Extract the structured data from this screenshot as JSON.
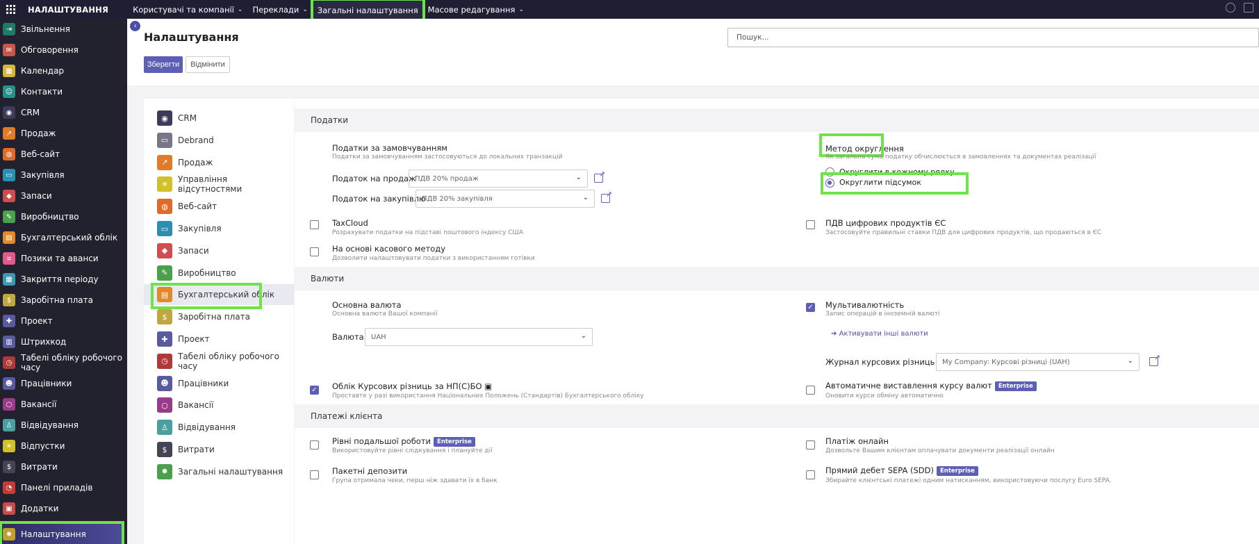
{
  "topbar": {
    "brand": "НАЛАШТУВАННЯ",
    "menu": [
      {
        "label": "Користувачі та компанії",
        "caret": true
      },
      {
        "label": "Переклади",
        "caret": true
      },
      {
        "label": "Загальні налаштування",
        "caret": false,
        "active": true
      },
      {
        "label": "Масове редагування",
        "caret": true
      }
    ]
  },
  "sidebar": {
    "items": [
      {
        "label": "Звільнення",
        "icon": "exit-icon",
        "color": "#1f7a6a"
      },
      {
        "label": "Обговорення",
        "icon": "chat-icon",
        "color": "#c8574b"
      },
      {
        "label": "Календар",
        "icon": "calendar-icon",
        "color": "#d2b73a"
      },
      {
        "label": "Контакти",
        "icon": "contacts-icon",
        "color": "#2a8f88"
      },
      {
        "label": "CRM",
        "icon": "crm-icon",
        "color": "#3c3c5a"
      },
      {
        "label": "Продаж",
        "icon": "chart-icon",
        "color": "#e07b2a"
      },
      {
        "label": "Веб-сайт",
        "icon": "globe-icon",
        "color": "#e06a2a"
      },
      {
        "label": "Закупівля",
        "icon": "card-icon",
        "color": "#2a8fb0"
      },
      {
        "label": "Запаси",
        "icon": "box-icon",
        "color": "#d24d4d"
      },
      {
        "label": "Виробництво",
        "icon": "wrench-icon",
        "color": "#4ba04b"
      },
      {
        "label": "Бухгалтерський облік",
        "icon": "ledger-icon",
        "color": "#e08a2a"
      },
      {
        "label": "Позики та аванси",
        "icon": "loan-icon",
        "color": "#e05a8a"
      },
      {
        "label": "Закриття періоду",
        "icon": "calendar-icon",
        "color": "#3a9ab0"
      },
      {
        "label": "Заробітна плата",
        "icon": "money-icon",
        "color": "#c0a840"
      },
      {
        "label": "Проект",
        "icon": "puzzle-icon",
        "color": "#5a5aa0"
      },
      {
        "label": "Штрихкод",
        "icon": "barcode-icon",
        "color": "#5a5aa0"
      },
      {
        "label": "Табелі обліку робочого часу",
        "icon": "clock-icon",
        "color": "#b03a3a"
      },
      {
        "label": "Працівники",
        "icon": "people-icon",
        "color": "#5a5aa0"
      },
      {
        "label": "Вакансії",
        "icon": "search-icon",
        "color": "#9a3a8a"
      },
      {
        "label": "Відвідування",
        "icon": "person-icon",
        "color": "#4aa0a0"
      },
      {
        "label": "Відпустки",
        "icon": "sun-icon",
        "color": "#d2c02a"
      },
      {
        "label": "Витрати",
        "icon": "dollar-icon",
        "color": "#444455"
      },
      {
        "label": "Панелі приладів",
        "icon": "gauge-icon",
        "color": "#c83a3a"
      },
      {
        "label": "Додатки",
        "icon": "apps-icon",
        "color": "#c84a4a"
      },
      {
        "label": "Налаштування",
        "icon": "gear-icon",
        "color": "#c0a030",
        "active": true
      }
    ]
  },
  "page": {
    "title": "Налаштування",
    "save": "Зберегти",
    "cancel": "Відмінити",
    "search_placeholder": "Пошук..."
  },
  "apps": [
    {
      "label": "CRM",
      "icon": "crm-icon",
      "color": "#3c3c5a"
    },
    {
      "label": "Debrand",
      "icon": "monitor-icon",
      "color": "#777788"
    },
    {
      "label": "Продаж",
      "icon": "chart-icon",
      "color": "#e07b2a"
    },
    {
      "label": "Управління відсутностями",
      "icon": "sun-icon",
      "color": "#d2c02a"
    },
    {
      "label": "Веб-сайт",
      "icon": "globe-icon",
      "color": "#e06a2a"
    },
    {
      "label": "Закупівля",
      "icon": "card-icon",
      "color": "#2a8fb0"
    },
    {
      "label": "Запаси",
      "icon": "box-icon",
      "color": "#d24d4d"
    },
    {
      "label": "Виробництво",
      "icon": "wrench-icon",
      "color": "#4ba04b"
    },
    {
      "label": "Бухгалтерський облік",
      "icon": "ledger-icon",
      "color": "#e08a2a",
      "active": true
    },
    {
      "label": "Заробітна плата",
      "icon": "money-icon",
      "color": "#c0a840"
    },
    {
      "label": "Проект",
      "icon": "puzzle-icon",
      "color": "#5a5aa0"
    },
    {
      "label": "Табелі обліку робочого часу",
      "icon": "clock-icon",
      "color": "#b03a3a"
    },
    {
      "label": "Працівники",
      "icon": "people-icon",
      "color": "#5a5aa0"
    },
    {
      "label": "Вакансії",
      "icon": "search-icon",
      "color": "#9a3a8a"
    },
    {
      "label": "Відвідування",
      "icon": "person-icon",
      "color": "#4aa0a0"
    },
    {
      "label": "Витрати",
      "icon": "dollar-icon",
      "color": "#444455"
    },
    {
      "label": "Загальні налаштування",
      "icon": "gear-icon",
      "color": "#4ba04b"
    }
  ],
  "taxes": {
    "section": "Податки",
    "default_taxes": {
      "title": "Податки за замовчуванням",
      "desc": "Податки за замовчуванням застосовуються до локальних транзакцій",
      "sales_label": "Податок на продаж",
      "sales_value": "ПДВ 20% продаж",
      "purchase_label": "Податок на закупівлю",
      "purchase_value": "ПДВ 20% закупівля"
    },
    "rounding": {
      "title": "Метод округлення",
      "desc": "Як загальна сума податку обчислюється в замовленнях та документах реалізації",
      "option1": "Округлити в кожному рядку",
      "option2": "Округлити підсумок"
    },
    "taxcloud": {
      "title": "TaxCloud",
      "desc": "Розрахувати податки на підставі поштового індексу США"
    },
    "eu_digital": {
      "title": "ПДВ цифрових продуктів ЄС",
      "desc": "Застосовуйте правильні ставки ПДВ для цифрових продуктів, що продаються в ЄС"
    },
    "cash_basis": {
      "title": "На основі касового методу",
      "desc": "Дозволити налаштовувати податки з використанням готівки"
    }
  },
  "currencies": {
    "section": "Валюти",
    "main": {
      "title": "Основна валюта",
      "desc": "Основна валюта Вашої компанії",
      "field_label": "Валюта",
      "value": "UAH"
    },
    "multi": {
      "title": "Мультивалютність",
      "desc": "Запис операцій в іноземній валюті",
      "link": "Активувати інші валюти",
      "journal_label": "Журнал курсових різниць",
      "journal_value": "My Company: Курсові різниці (UAH)"
    },
    "exchange_diff": {
      "title": "Облік Курсових різниць за НП(С)БО",
      "desc": "Проставте у разі використання Національних Положень (Стандартів) Бухгалтерського обліку"
    },
    "auto_rates": {
      "title": "Автоматичне виставлення курсу валют",
      "badge": "Enterprise",
      "desc": "Оновити курси обміну автоматично"
    }
  },
  "payments": {
    "section": "Платежі клієнта",
    "followup": {
      "title": "Рівні подальшої роботи",
      "badge": "Enterprise",
      "desc": "Використовуйте рівні слідкування і плануйте дії"
    },
    "online": {
      "title": "Платіж онлайн",
      "desc": "Дозвольте Вашим клієнтам оплачувати документи реалізації онлайн"
    },
    "batch": {
      "title": "Пакетні депозити",
      "desc": "Група отримала чеки, перш ніж здавати їх в банк"
    },
    "sepa": {
      "title": "Прямий дебет SEPA (SDD)",
      "badge": "Enterprise",
      "desc": "Збирайте клієнтські платежі одним натисканням, використовуючи послугу Euro SEPA."
    }
  }
}
